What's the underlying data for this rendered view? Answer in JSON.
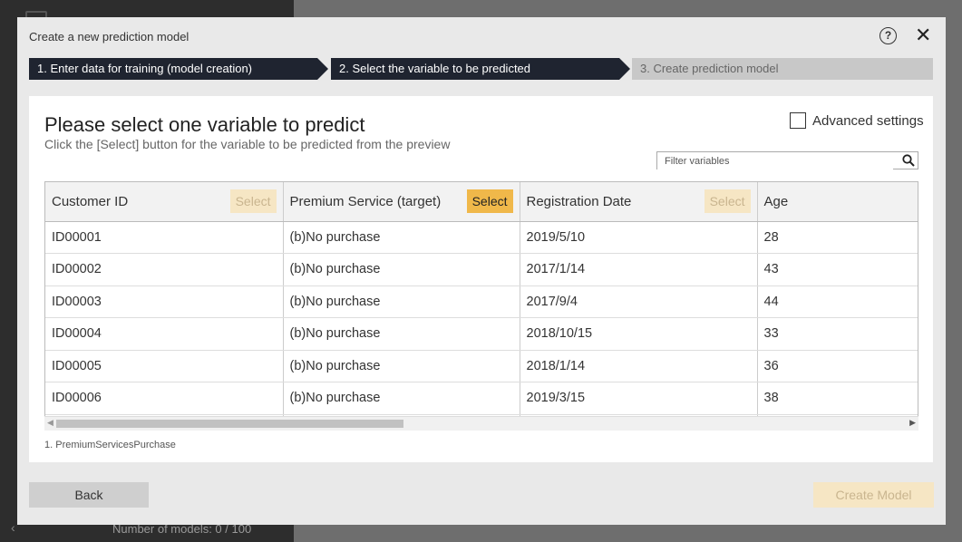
{
  "background": {
    "footer_text": "Number of models: 0 / 100"
  },
  "modal": {
    "title": "Create a new prediction model",
    "help_icon": "?",
    "close_icon": "✕"
  },
  "steps": [
    {
      "label": "1. Enter data for training (model creation)",
      "state": "done"
    },
    {
      "label": "2. Select the variable to be predicted",
      "state": "current"
    },
    {
      "label": "3. Create prediction model",
      "state": "pending"
    }
  ],
  "panel": {
    "heading": "Please select one variable to predict",
    "subheading": "Click the [Select] button for the variable to be predicted from the preview",
    "advanced_settings_label": "Advanced settings",
    "advanced_settings_checked": false,
    "filter_placeholder": "Filter variables",
    "file_name": "1. PremiumServicesPurchase"
  },
  "table": {
    "columns": [
      {
        "name": "Customer ID",
        "select_label": "Select",
        "selected": false
      },
      {
        "name": "Premium Service (target)",
        "select_label": "Select",
        "selected": true
      },
      {
        "name": "Registration Date",
        "select_label": "Select",
        "selected": false
      },
      {
        "name": "Age",
        "select_label": "",
        "selected": false
      }
    ],
    "rows": [
      [
        "ID00001",
        "(b)No purchase",
        "2019/5/10",
        "28"
      ],
      [
        "ID00002",
        "(b)No purchase",
        "2017/1/14",
        "43"
      ],
      [
        "ID00003",
        "(b)No purchase",
        "2017/9/4",
        "44"
      ],
      [
        "ID00004",
        "(b)No purchase",
        "2018/10/15",
        "33"
      ],
      [
        "ID00005",
        "(b)No purchase",
        "2018/1/14",
        "36"
      ],
      [
        "ID00006",
        "(b)No purchase",
        "2019/3/15",
        "38"
      ],
      [
        "",
        "",
        "",
        ""
      ]
    ]
  },
  "footer": {
    "back_label": "Back",
    "create_label": "Create Model"
  },
  "colors": {
    "step_active": "#1f2430",
    "step_pending": "#c8c8c8",
    "select_active": "#f0b84a",
    "select_disabled": "#f6e6c4"
  }
}
